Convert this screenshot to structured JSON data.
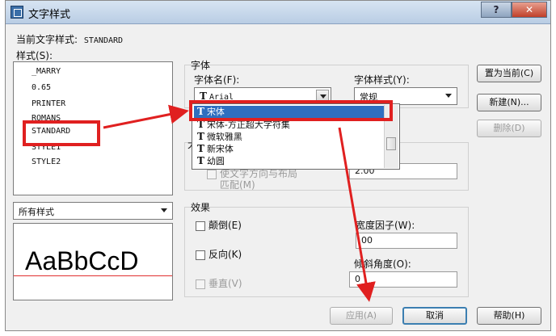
{
  "window": {
    "title": "文字样式",
    "help_label": "?",
    "close_label": "✕"
  },
  "current_style": {
    "label": "当前文字样式:",
    "value": "STANDARD"
  },
  "styles": {
    "label": "样式(S):",
    "items": [
      {
        "text": "_MARRY"
      },
      {
        "text": "0.65"
      },
      {
        "text": "PRINTER"
      },
      {
        "text": "ROMANS"
      },
      {
        "text": "STANDARD"
      },
      {
        "text": "STYLE1"
      },
      {
        "text": "STYLE2"
      }
    ],
    "filter_value": "所有样式"
  },
  "preview": {
    "text": "AaBbCcD"
  },
  "font": {
    "group_label": "字体",
    "name_label": "字体名(F):",
    "name_value": "Arial",
    "style_label": "字体样式(Y):",
    "style_value": "常规",
    "dropdown_items": [
      {
        "text": "宋体"
      },
      {
        "text": "宋体-方正超大字符集"
      },
      {
        "text": "微软雅黑"
      },
      {
        "text": "新宋体"
      },
      {
        "text": "幼圆"
      }
    ]
  },
  "size": {
    "group_label_partial": "大",
    "orientation_label_line1": "使文字方向与布局",
    "orientation_label_line2": "匹配(M)",
    "height_value": "2.00"
  },
  "effects": {
    "group_label": "效果",
    "upside_down_label": "颠倒(E)",
    "backwards_label": "反向(K)",
    "vertical_label": "垂直(V)",
    "width_factor_label": "宽度因子(W):",
    "width_factor_value": "00",
    "oblique_label": "倾斜角度(O):",
    "oblique_value": "0"
  },
  "buttons": {
    "set_current": "置为当前(C)",
    "new": "新建(N)...",
    "delete": "删除(D)",
    "apply": "应用(A)",
    "cancel": "取消",
    "help": "帮助(H)"
  },
  "colors": {
    "annotation_red": "#e02020",
    "selection_blue": "#2f6fc0"
  }
}
